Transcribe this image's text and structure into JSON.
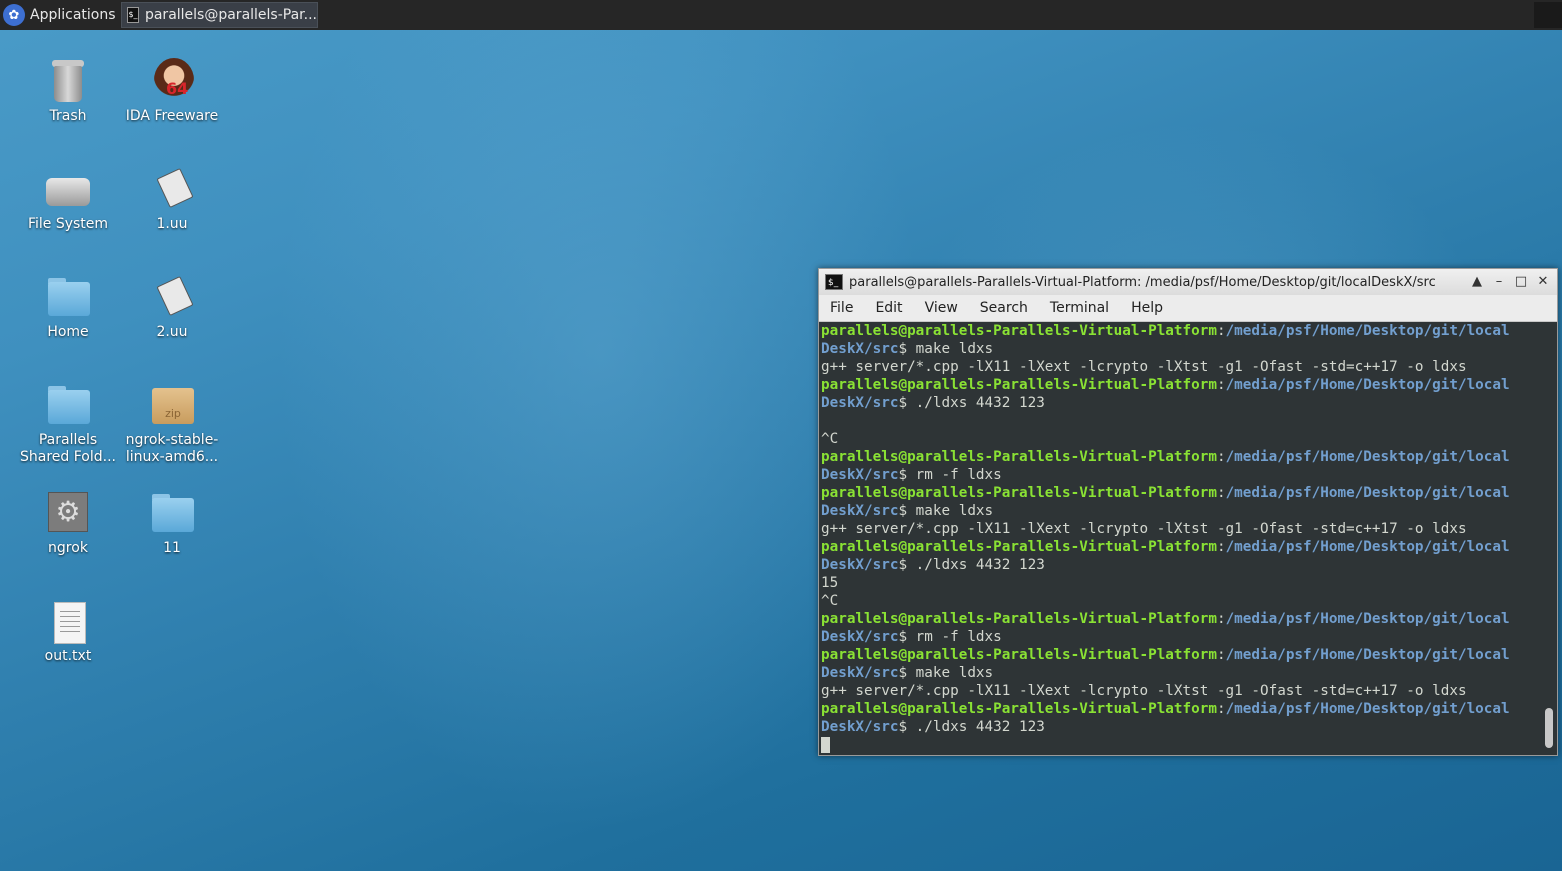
{
  "panel": {
    "applications_label": "Applications",
    "task_label": "parallels@parallels-Par..."
  },
  "desktop_icons": [
    {
      "label": "Trash",
      "icon": "trash-icon"
    },
    {
      "label": "IDA Freeware",
      "icon": "ida-icon",
      "badge": "64"
    },
    {
      "label": "File System",
      "icon": "drive-icon"
    },
    {
      "label": "1.uu",
      "icon": "file-icon"
    },
    {
      "label": "Home",
      "icon": "home-folder-icon"
    },
    {
      "label": "2.uu",
      "icon": "file-icon"
    },
    {
      "label": "Parallels Shared Fold...",
      "icon": "shared-folder-icon"
    },
    {
      "label": "ngrok-stable-linux-amd6...",
      "icon": "zip-icon",
      "badge": "zip"
    },
    {
      "label": "ngrok",
      "icon": "gear-icon"
    },
    {
      "label": "11",
      "icon": "folder-icon"
    },
    {
      "label": "out.txt",
      "icon": "text-file-icon"
    }
  ],
  "terminal": {
    "title": "parallels@parallels-Parallels-Virtual-Platform: /media/psf/Home/Desktop/git/localDeskX/src",
    "menu": [
      "File",
      "Edit",
      "View",
      "Search",
      "Terminal",
      "Help"
    ],
    "prompt_user": "parallels@parallels-Parallels-Virtual-Platform",
    "prompt_path_1": "/media/psf/Home/Desktop/git/local",
    "prompt_path_2": "DeskX/src",
    "lines": [
      {
        "type": "prompt_head"
      },
      {
        "type": "prompt_tail",
        "cmd": "make ldxs"
      },
      {
        "type": "out",
        "text": "g++ server/*.cpp -lX11 -lXext -lcrypto -lXtst -g1 -Ofast -std=c++17 -o ldxs"
      },
      {
        "type": "prompt_head"
      },
      {
        "type": "prompt_tail",
        "cmd": "./ldxs 4432 123"
      },
      {
        "type": "out",
        "text": ""
      },
      {
        "type": "out",
        "text": "^C"
      },
      {
        "type": "prompt_head"
      },
      {
        "type": "prompt_tail",
        "cmd": "rm -f ldxs"
      },
      {
        "type": "prompt_head"
      },
      {
        "type": "prompt_tail",
        "cmd": "make ldxs"
      },
      {
        "type": "out",
        "text": "g++ server/*.cpp -lX11 -lXext -lcrypto -lXtst -g1 -Ofast -std=c++17 -o ldxs"
      },
      {
        "type": "prompt_head"
      },
      {
        "type": "prompt_tail",
        "cmd": "./ldxs 4432 123"
      },
      {
        "type": "out",
        "text": "15"
      },
      {
        "type": "out",
        "text": "^C"
      },
      {
        "type": "prompt_head"
      },
      {
        "type": "prompt_tail",
        "cmd": "rm -f ldxs"
      },
      {
        "type": "prompt_head"
      },
      {
        "type": "prompt_tail",
        "cmd": "make ldxs"
      },
      {
        "type": "out",
        "text": "g++ server/*.cpp -lX11 -lXext -lcrypto -lXtst -g1 -Ofast -std=c++17 -o ldxs"
      },
      {
        "type": "prompt_head"
      },
      {
        "type": "prompt_tail",
        "cmd": "./ldxs 4432 123"
      },
      {
        "type": "cursor"
      }
    ]
  }
}
